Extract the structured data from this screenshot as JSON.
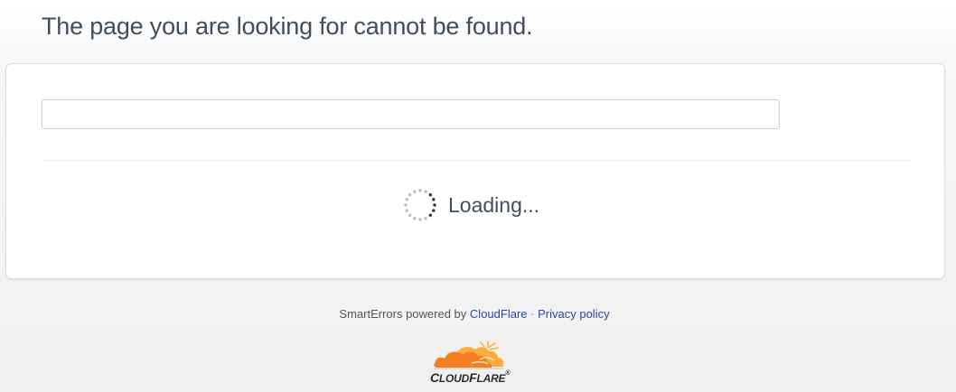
{
  "page": {
    "title": "The page you are looking for cannot be found."
  },
  "search": {
    "value": "",
    "placeholder": ""
  },
  "status": {
    "loading_text": "Loading..."
  },
  "footer": {
    "prefix": "SmartErrors powered by",
    "cloudflare_link": "CloudFlare",
    "separator": "·",
    "privacy_link": "Privacy policy"
  },
  "logo": {
    "wordmark_c": "C",
    "wordmark_rest": "LOUD",
    "wordmark_f": "F",
    "wordmark_end": "LARE",
    "trademark": "®",
    "icon": "cloudflare-cloud-logo"
  },
  "icons": {
    "spinner": "loading-spinner-icon"
  },
  "colors": {
    "title": "#404f5e",
    "link": "#2b48a8",
    "cloud_orange": "#f38020",
    "cloud_light": "#faad3f"
  }
}
